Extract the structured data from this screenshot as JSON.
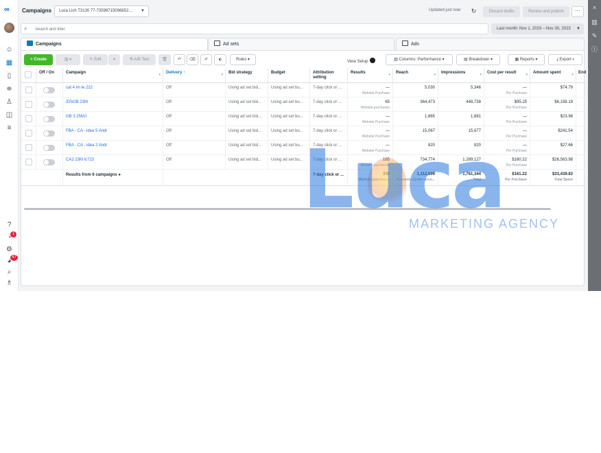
{
  "header": {
    "title": "Campaigns",
    "account": "Luca Lich T3130 77-73598715096852...",
    "updated": "Updated just now",
    "discard": "Discard drafts",
    "review": "Review and publish",
    "more": "···"
  },
  "search": {
    "placeholder": "Search and filter"
  },
  "date_range": "Last month: Nov 1, 2023 – Nov 30, 2023",
  "tabs": [
    {
      "label": "Campaigns"
    },
    {
      "label": "Ad sets"
    },
    {
      "label": "Ads"
    }
  ],
  "toolbar": {
    "create": "+ Create",
    "edit": "Edit",
    "ab_test": "A/B Test",
    "rules": "Rules",
    "view_setup": "View Setup",
    "columns": "Columns: Performance",
    "breakdown": "Breakdown",
    "reports": "Reports",
    "export": "Export"
  },
  "table": {
    "headers": {
      "offon": "Off / On",
      "campaign": "Campaign",
      "delivery": "Delivery ↑",
      "bid": "Bid strategy",
      "budget": "Budget",
      "attribution": "Attribution setting",
      "results": "Results",
      "reach": "Reach",
      "impressions": "Impressions",
      "cpr": "Cost per result",
      "spent": "Amount spent",
      "ends": "End"
    },
    "rows": [
      {
        "name": "cat 4 im le 222",
        "delivery": "Off",
        "bid": "Using ad set bid...",
        "budget": "Using ad set bu...",
        "attribution": "7-day click or ...",
        "results": "—",
        "results_sub": "Website Purchase",
        "reach": "5,030",
        "impressions": "5,346",
        "cpr": "—",
        "cpr_sub": "Per Purchase",
        "spent": "$74.79"
      },
      {
        "name": "IDSGB 23M",
        "delivery": "Off",
        "bid": "Using ad set bid...",
        "budget": "Using ad set bu...",
        "attribution": "7-day click or ...",
        "results": "65",
        "results_sub": "Website purchases",
        "reach": "364,473",
        "impressions": "448,738",
        "cpr": "$95.25",
        "cpr_sub": "Per Purchase",
        "spent": "$6,158.19"
      },
      {
        "name": "GB 3 25MJ",
        "delivery": "Off",
        "bid": "Using ad set bid...",
        "budget": "Using ad set bu...",
        "attribution": "7-day click or ...",
        "results": "—",
        "results_sub": "Website Purchase",
        "reach": "1,865",
        "impressions": "1,881",
        "cpr": "—",
        "cpr_sub": "Per Purchase",
        "spent": "$23.98"
      },
      {
        "name": "FBA - CA - idea 5 Andr",
        "delivery": "Off",
        "bid": "Using ad set bid...",
        "budget": "Using ad set bu...",
        "attribution": "7-day click or ...",
        "results": "—",
        "results_sub": "Website Purchase",
        "reach": "15,067",
        "impressions": "15,677",
        "cpr": "—",
        "cpr_sub": "Per Purchase",
        "spent": "$241.54"
      },
      {
        "name": "FBA - CA - idea 2 Andr",
        "delivery": "Off",
        "bid": "Using ad set bid...",
        "budget": "Using ad set bu...",
        "attribution": "7-day click or ...",
        "results": "—",
        "results_sub": "Website Purchase",
        "reach": "820",
        "impressions": "820",
        "cpr": "—",
        "cpr_sub": "Per Purchase",
        "spent": "$27.66"
      },
      {
        "name": "CA2 23M lc723",
        "delivery": "Off",
        "bid": "Using ad set bid...",
        "budget": "Using ad set bu...",
        "attribution": "7-day click or ...",
        "results": "165",
        "results_sub": "Website purchases",
        "reach": "734,774",
        "impressions": "1,289,127",
        "cpr": "$160.22",
        "cpr_sub": "Per Purchase",
        "spent": "$26,563.98"
      }
    ],
    "totals": {
      "label": "Results from 6 campaigns",
      "attribution": "7-day click or ...",
      "results": "335",
      "results_sub": "Website purchases",
      "reach": "1,112,699",
      "reach_sub": "Accounts Center acco...",
      "impressions": "1,761,344",
      "impressions_sub": "Total",
      "cpr": "$161.22",
      "cpr_sub": "Per Purchase",
      "spent": "$33,439.83",
      "spent_sub": "Total Spent"
    }
  },
  "watermark": {
    "word": "Luca",
    "tagline": "MARKETING AGENCY"
  },
  "colors": {
    "accent": "#0a78be",
    "create": "#42b72a",
    "link": "#216fdb"
  }
}
